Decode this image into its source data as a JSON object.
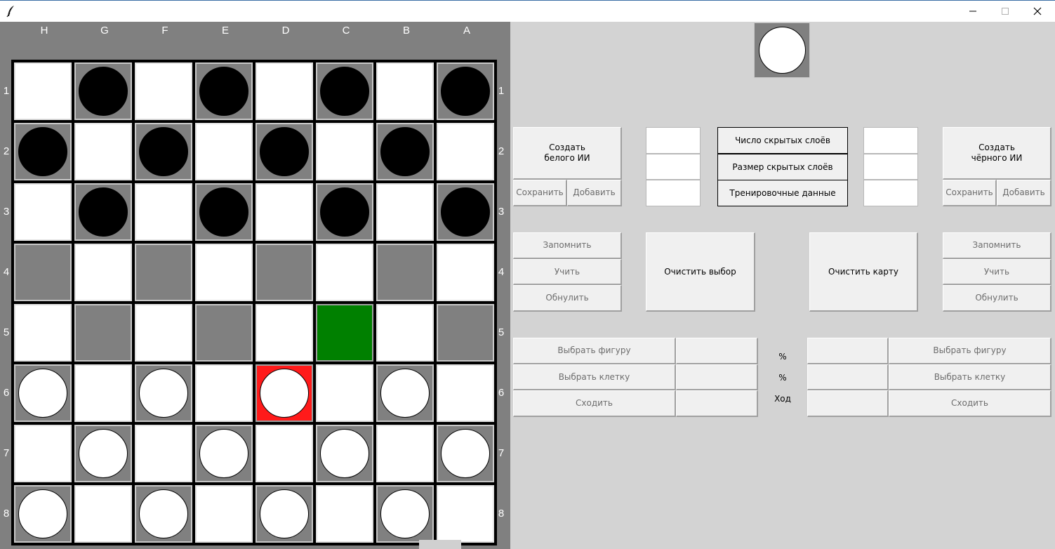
{
  "window": {
    "icon": "feather-icon",
    "controls": [
      "minimize-icon",
      "maximize-icon",
      "close-icon"
    ]
  },
  "board": {
    "files": [
      "H",
      "G",
      "F",
      "E",
      "D",
      "C",
      "B",
      "A"
    ],
    "ranks": [
      "1",
      "2",
      "3",
      "4",
      "5",
      "6",
      "7",
      "8"
    ],
    "squares": [
      [
        "w",
        "B",
        "w",
        "B",
        "w",
        "B",
        "w",
        "B"
      ],
      [
        "B",
        "w",
        "B",
        "w",
        "B",
        "w",
        "B",
        "w"
      ],
      [
        "w",
        "B",
        "w",
        "B",
        "w",
        "B",
        "w",
        "B"
      ],
      [
        "D",
        "w",
        "D",
        "w",
        "D",
        "w",
        "D",
        "w"
      ],
      [
        "w",
        "D",
        "w",
        "D",
        "w",
        "G",
        "w",
        "D"
      ],
      [
        "W",
        "w",
        "W",
        "w",
        "R",
        "w",
        "W",
        "w"
      ],
      [
        "w",
        "W",
        "w",
        "W",
        "w",
        "W",
        "w",
        "W"
      ],
      [
        "W",
        "w",
        "W",
        "w",
        "W",
        "w",
        "W",
        "w"
      ]
    ],
    "legend": {
      "w": "white-square",
      "D": "dark-square",
      "B": "black-piece",
      "W": "white-piece",
      "G": "selected-target",
      "R": "selected-piece"
    },
    "colors": {
      "dark": "#808080",
      "light": "#ffffff",
      "target": "#008000",
      "selected": "#ff1a1a"
    }
  },
  "turn_indicator": {
    "piece": "white"
  },
  "white_ai": {
    "create": "Создать\nбелого ИИ",
    "save": "Сохранить",
    "add": "Добавить",
    "remember": "Запомнить",
    "learn": "Учить",
    "reset": "Обнулить"
  },
  "black_ai": {
    "create": "Создать\nчёрного ИИ",
    "save": "Сохранить",
    "add": "Добавить",
    "remember": "Запомнить",
    "learn": "Учить",
    "reset": "Обнулить"
  },
  "params": {
    "hidden_layers_count": "Число скрытых слоёв",
    "hidden_layers_size": "Размер скрытых слоёв",
    "training_data": "Тренировочные данные"
  },
  "center": {
    "clear_selection": "Очистить выбор",
    "clear_map": "Очистить карту"
  },
  "moves": {
    "select_piece": "Выбрать фигуру",
    "select_cell": "Выбрать клетку",
    "make_move": "Сходить",
    "pct1": "%",
    "pct2": "%",
    "turn": "Ход"
  }
}
